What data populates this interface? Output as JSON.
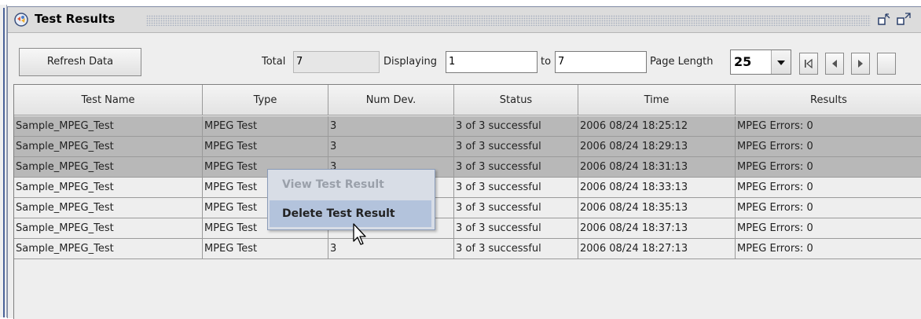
{
  "window": {
    "title": "Test Results"
  },
  "toolbar": {
    "refresh_label": "Refresh Data",
    "total_label": "Total",
    "total_value": "7",
    "displaying_label": "Displaying",
    "displaying_from": "1",
    "to_label": "to",
    "displaying_to": "7",
    "page_length_label": "Page Length",
    "page_length_value": "25"
  },
  "table": {
    "columns": [
      "Test Name",
      "Type",
      "Num Dev.",
      "Status",
      "Time",
      "Results"
    ],
    "rows": [
      [
        "Sample_MPEG_Test",
        "MPEG Test",
        "3",
        "3 of 3 successful",
        "2006 08/24  18:25:12",
        "MPEG Errors: 0"
      ],
      [
        "Sample_MPEG_Test",
        "MPEG Test",
        "3",
        "3 of 3 successful",
        "2006 08/24  18:29:13",
        "MPEG Errors: 0"
      ],
      [
        "Sample_MPEG_Test",
        "MPEG Test",
        "3",
        "3 of 3 successful",
        "2006 08/24  18:31:13",
        "MPEG Errors: 0"
      ],
      [
        "Sample_MPEG_Test",
        "MPEG Test",
        "",
        "3 of 3 successful",
        "2006 08/24  18:33:13",
        "MPEG Errors: 0"
      ],
      [
        "Sample_MPEG_Test",
        "MPEG Test",
        "",
        "3 of 3 successful",
        "2006 08/24  18:35:13",
        "MPEG Errors: 0"
      ],
      [
        "Sample_MPEG_Test",
        "MPEG Test",
        "",
        "3 of 3 successful",
        "2006 08/24  18:37:13",
        "MPEG Errors: 0"
      ],
      [
        "Sample_MPEG_Test",
        "MPEG Test",
        "3",
        "3 of 3 successful",
        "2006 08/24  18:27:13",
        "MPEG Errors: 0"
      ]
    ],
    "selected_rows": [
      0,
      1,
      2
    ]
  },
  "context_menu": {
    "items": [
      {
        "label": "View Test Result",
        "enabled": false
      },
      {
        "label": "Delete Test Result",
        "enabled": true
      }
    ]
  },
  "icons": {
    "app": "test-results-app-icon",
    "restore": "restore-icon",
    "maximize": "maximize-icon",
    "combo_arrow": "chevron-down-icon",
    "first_page": "first-page-icon",
    "prev_page": "previous-page-icon",
    "next_page": "next-page-icon"
  },
  "colors": {
    "selected_row": "#b8b8b8",
    "menu_highlight": "#b3c3dc",
    "frame_border": "#4a6298"
  }
}
